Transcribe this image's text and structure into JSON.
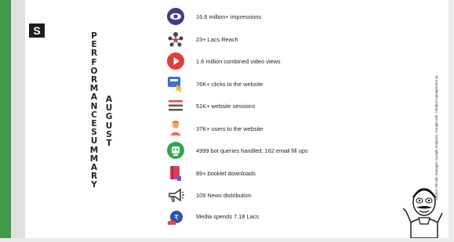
{
  "slide": {
    "logo_letter": "S",
    "vertical_title": "PERFORMANCE SUMMARY",
    "vertical_month": "AUGUST",
    "source_note": "Source: FB Ads manager, Google Analytics, Google Ads, Chatbot management system and tracking codes",
    "items": [
      {
        "label": "16.6 million+ impressions",
        "icon": "eye-icon"
      },
      {
        "label": "23+ Lacs Reach",
        "icon": "people-network-icon"
      },
      {
        "label": "1.6 million combined video views",
        "icon": "play-icon"
      },
      {
        "label": "76K+ clicks to the website",
        "icon": "click-icon"
      },
      {
        "label": "51K+ website sessions",
        "icon": "menu-lines-icon"
      },
      {
        "label": "37K+ users to the website",
        "icon": "user-icon"
      },
      {
        "label": "4999 bot queries handled; 162 email fill ups",
        "icon": "chatbot-icon"
      },
      {
        "label": "89+ booklet downloads",
        "icon": "booklet-icon"
      },
      {
        "label": "109 News distribution",
        "icon": "megaphone-icon"
      },
      {
        "label": "Media spends 7.18 Lacs",
        "icon": "money-bag-icon"
      }
    ]
  }
}
